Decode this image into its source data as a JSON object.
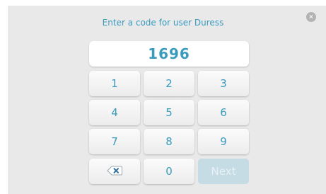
{
  "prompt": "Enter a code for user Duress",
  "code_value": "1696",
  "close_label": "×",
  "keypad": {
    "k1": "1",
    "k2": "2",
    "k3": "3",
    "k4": "4",
    "k5": "5",
    "k6": "6",
    "k7": "7",
    "k8": "8",
    "k9": "9",
    "k0": "0",
    "next": "Next",
    "backspace_icon": "backspace-icon"
  },
  "colors": {
    "accent": "#3a9bbd",
    "panel_background": "#e9e9e9",
    "key_background": "#f5f5f5",
    "disabled_key": "#c6dce4"
  }
}
